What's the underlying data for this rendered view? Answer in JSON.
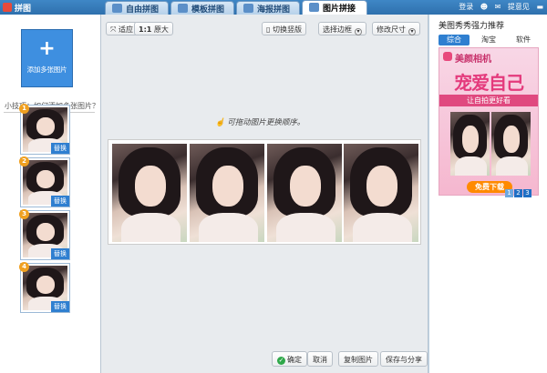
{
  "app": {
    "title": "拼图"
  },
  "tabs": [
    {
      "label": "自由拼图",
      "active": false
    },
    {
      "label": "模板拼图",
      "active": false
    },
    {
      "label": "海报拼图",
      "active": false
    },
    {
      "label": "图片拼接",
      "active": true
    }
  ],
  "titlebar_right": {
    "login": "登录",
    "feedback": "提意见"
  },
  "left_panel": {
    "add_button": "添加多张图片",
    "tip": "小技巧：如何添加多张图片？",
    "thumbnails": [
      {
        "index": "1",
        "swap": "替换"
      },
      {
        "index": "2",
        "swap": "替换"
      },
      {
        "index": "3",
        "swap": "替换"
      },
      {
        "index": "4",
        "swap": "替换"
      }
    ]
  },
  "toolbar": {
    "fit_label": "适应",
    "actual_label": "原大",
    "actual_prefix": "1:1",
    "orientation_label": "切换竖版",
    "border_label": "选择边框",
    "resize_label": "修改尺寸"
  },
  "canvas": {
    "hint": "可拖动图片更换顺序。"
  },
  "bottom_buttons": {
    "ok": "确定",
    "cancel": "取消",
    "copy": "复制图片",
    "save": "保存与分享"
  },
  "right_panel": {
    "title": "美图秀秀强力推荐",
    "tabs": [
      {
        "label": "综合",
        "active": true
      },
      {
        "label": "淘宝",
        "active": false
      },
      {
        "label": "软件",
        "active": false
      }
    ],
    "ad": {
      "brand": "美颜相机",
      "headline": "宠爱自己",
      "subline": "让自拍更好看",
      "cta": "免费下载",
      "pages": [
        "1",
        "2",
        "3"
      ]
    }
  }
}
